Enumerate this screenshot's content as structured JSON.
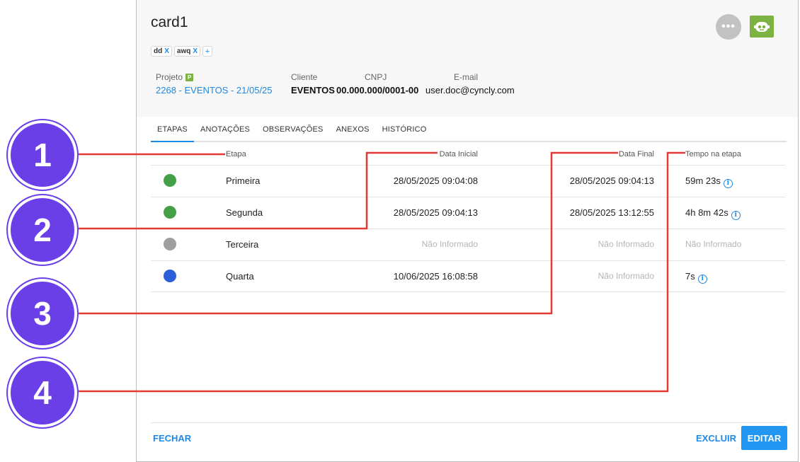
{
  "card": {
    "title": "card1",
    "tags": [
      {
        "label": "dd",
        "remove": "X"
      },
      {
        "label": "awq",
        "remove": "X"
      }
    ],
    "add_tag": "+"
  },
  "info": {
    "projeto_label": "Projeto",
    "projeto_badge": "P",
    "projeto_value": "2268 - EVENTOS - 21/05/25",
    "cliente_label": "Cliente",
    "cliente_value": "EVENTOS",
    "cnpj_label": "CNPJ",
    "cnpj_value": "00.000.000/0001-00",
    "email_label": "E-mail",
    "email_value": "user.doc@cyncly.com"
  },
  "actions": {
    "more": "•••"
  },
  "tabs": [
    "ETAPAS",
    "ANOTAÇÕES",
    "OBSERVAÇÕES",
    "ANEXOS",
    "HISTÓRICO"
  ],
  "table": {
    "headers": {
      "etapa": "Etapa",
      "data_inicial": "Data Inicial",
      "data_final": "Data Final",
      "tempo": "Tempo na etapa"
    },
    "rows": [
      {
        "status_color": "#43a047",
        "etapa": "Primeira",
        "data_inicial": "28/05/2025 09:04:08",
        "data_final": "28/05/2025 09:04:13",
        "tempo": "59m 23s"
      },
      {
        "status_color": "#43a047",
        "etapa": "Segunda",
        "data_inicial": "28/05/2025 09:04:13",
        "data_final": "28/05/2025 13:12:55",
        "tempo": "4h 8m 42s"
      },
      {
        "status_color": "#9e9e9e",
        "etapa": "Terceira",
        "data_inicial": "Não Informado",
        "data_final": "Não Informado",
        "tempo": "Não Informado"
      },
      {
        "status_color": "#2a5fd8",
        "etapa": "Quarta",
        "data_inicial": "10/06/2025 16:08:58",
        "data_final": "Não Informado",
        "tempo": "7s"
      }
    ],
    "info_glyph": "i"
  },
  "footer": {
    "close": "FECHAR",
    "delete": "EXCLUIR",
    "edit": "EDITAR"
  },
  "callouts": [
    "1",
    "2",
    "3",
    "4"
  ],
  "colors": {
    "accent": "#1e88e5",
    "callout": "#6a3fe8",
    "callout_line": "#e53935",
    "robot": "#7cb342"
  }
}
